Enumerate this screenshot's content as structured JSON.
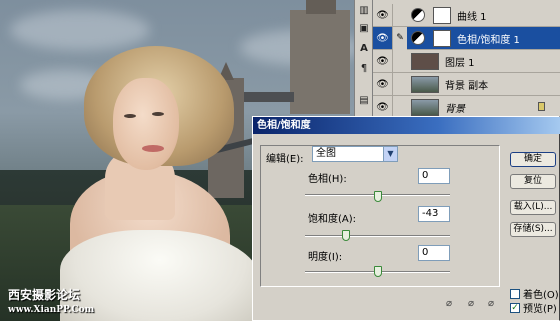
{
  "watermark": {
    "line1": "西安摄影论坛",
    "line2": "www.XianPP.Com"
  },
  "layers_panel": {
    "layers": [
      {
        "name": "曲线 1",
        "type": "adjustment-curves",
        "visible": true,
        "active": false,
        "thumb_color": "#ffffff"
      },
      {
        "name": "色相/饱和度 1",
        "type": "adjustment-hue-saturation",
        "visible": true,
        "active": true,
        "thumb_color": "#ffffff"
      },
      {
        "name": "图层 1",
        "type": "pixel",
        "visible": true,
        "active": false,
        "thumb_color": "#5e4e48"
      },
      {
        "name": "背景 副本",
        "type": "pixel",
        "visible": true,
        "active": false,
        "thumb_color": "#6a7a86"
      },
      {
        "name": "背景",
        "type": "background",
        "visible": true,
        "active": false,
        "locked": true,
        "thumb_color": "#6a7a86"
      }
    ]
  },
  "dialog": {
    "title": "色相/饱和度",
    "edit_label": "编辑(E):",
    "edit_value": "全图",
    "params": [
      {
        "label": "色相(H):",
        "value": "0",
        "slider_fraction": 0.5
      },
      {
        "label": "饱和度(A):",
        "value": "-43",
        "slider_fraction": 0.285
      },
      {
        "label": "明度(I):",
        "value": "0",
        "slider_fraction": 0.5
      }
    ],
    "buttons": {
      "ok": "确定",
      "reset": "复位",
      "load": "载入(L)...",
      "save": "存储(S)..."
    },
    "colorize_label": "着色(O)",
    "colorize_checked": false,
    "preview_label": "预览(P)",
    "preview_checked": true
  },
  "colors": {
    "titlebar": "#0a246a",
    "selected_layer": "#1a4fa0",
    "dialog_bg": "#d4d0c8"
  }
}
